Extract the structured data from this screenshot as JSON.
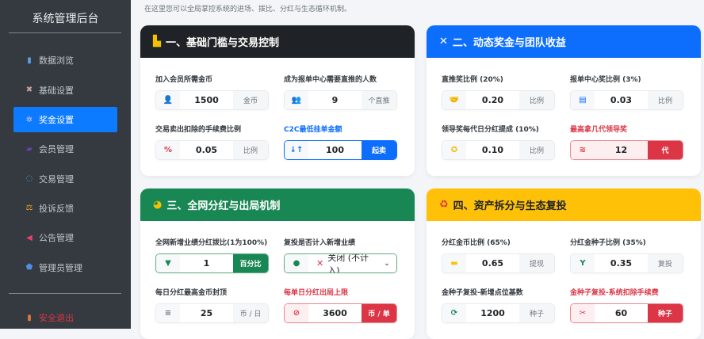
{
  "sidebar": {
    "title": "系统管理后台",
    "items": [
      {
        "label": "数据浏览",
        "icon": "bar-chart-icon",
        "glyph": "▮",
        "color": "#5aa0e6"
      },
      {
        "label": "基础设置",
        "icon": "tools-icon",
        "glyph": "✖",
        "color": "#c9a0a0"
      },
      {
        "label": "奖金设置",
        "icon": "gear-icon",
        "glyph": "✲",
        "color": "#d8c8ff",
        "active": true
      },
      {
        "label": "会员管理",
        "icon": "users-icon",
        "glyph": "▰",
        "color": "#6c3fb0"
      },
      {
        "label": "交易管理",
        "icon": "exchange-icon",
        "glyph": "◌",
        "color": "#4da3e0"
      },
      {
        "label": "投诉反馈",
        "icon": "scale-icon",
        "glyph": "⚖",
        "color": "#f0a020"
      },
      {
        "label": "公告管理",
        "icon": "megaphone-icon",
        "glyph": "◀",
        "color": "#e83e6c"
      },
      {
        "label": "管理员管理",
        "icon": "shield-icon",
        "glyph": "⬟",
        "color": "#4d8fe6"
      }
    ],
    "logout": {
      "label": "安全退出",
      "icon": "door-icon",
      "glyph": "▮",
      "color": "#e07a3a"
    }
  },
  "subtitle": "在这里您可以全局掌控系统的进场、拨比、分红与生态循环机制。",
  "cards": [
    {
      "title": "一、基础门槛与交易控制",
      "icon": "door-icon",
      "glyph": "▙",
      "icon_color": "#f5c000",
      "bg": "#1f2226",
      "fields": [
        {
          "label": "加入会员所需金币",
          "value": "1500",
          "suffix": "金币",
          "icon": "user-plus-icon",
          "glyph": "👤",
          "icolor": "#0d6efd"
        },
        {
          "label": "成为报单中心需要直推的人数",
          "value": "9",
          "suffix": "个直推",
          "icon": "users-icon",
          "glyph": "👥",
          "icolor": "#3ab0e0"
        },
        {
          "label": "交易卖出扣除的手续费比例",
          "value": "0.05",
          "suffix": "比例",
          "icon": "percent-icon",
          "glyph": "%",
          "icolor": "#dc3545"
        },
        {
          "label": "C2C最低挂单金额",
          "value": "100",
          "suffix": "起卖",
          "icon": "sort-icon",
          "glyph": "↓↑",
          "icolor": "#0d6efd",
          "style": "blue"
        }
      ]
    },
    {
      "title": "二、动态奖金与团队收益",
      "icon": "network-icon",
      "glyph": "✕",
      "icon_color": "#ffffff",
      "bg": "#0d6efd",
      "fields": [
        {
          "label": "直推奖比例 (20%)",
          "value": "0.20",
          "suffix": "比例",
          "icon": "handshake-icon",
          "glyph": "🤝",
          "icolor": "#0d6efd"
        },
        {
          "label": "报单中心奖比例 (3%)",
          "value": "0.03",
          "suffix": "比例",
          "icon": "store-icon",
          "glyph": "▤",
          "icolor": "#0d6efd"
        },
        {
          "label": "领导奖每代日分红提成 (10%)",
          "value": "0.10",
          "suffix": "比例",
          "icon": "award-icon",
          "glyph": "✪",
          "icolor": "#f5b800"
        },
        {
          "label": "最高拿几代领导奖",
          "value": "12",
          "suffix": "代",
          "icon": "layers-icon",
          "glyph": "≋",
          "icolor": "#dc3545",
          "style": "red"
        }
      ]
    },
    {
      "title": "三、全网分红与出局机制",
      "icon": "pie-chart-icon",
      "glyph": "◕",
      "icon_color": "#f5c000",
      "bg": "#198754",
      "fields": [
        {
          "label": "全网新增业绩分红拨比(1为100%)",
          "value": "1",
          "suffix": "百分比",
          "icon": "filter-icon",
          "glyph": "▼",
          "icolor": "#198754",
          "style": "green"
        },
        {
          "label": "复投是否计入新增业绩",
          "value": "关闭 (不计入)",
          "prefix": "✕",
          "suffix": "⌄",
          "icon": "toggle-icon",
          "glyph": "●",
          "icolor": "#198754",
          "style": "green sel"
        },
        {
          "label": "每日分红最高金币封顶",
          "value": "25",
          "suffix": "币 / 日",
          "icon": "coins-icon",
          "glyph": "≡",
          "icolor": "#6c757d"
        },
        {
          "label": "每单日分红出局上限",
          "value": "3600",
          "suffix": "币 / 单",
          "icon": "ban-icon",
          "glyph": "⊘",
          "icolor": "#dc3545",
          "style": "red wv"
        }
      ]
    },
    {
      "title": "四、资产拆分与生态复投",
      "icon": "recycle-icon",
      "glyph": "♻",
      "icon_color": "#dc3545",
      "bg": "#ffc107",
      "title_color": "#212529",
      "fields": [
        {
          "label": "分红金币比例 (65%)",
          "value": "0.65",
          "suffix": "提现",
          "icon": "wallet-icon",
          "glyph": "▬",
          "icolor": "#ffc107"
        },
        {
          "label": "分红金种子比例 (35%)",
          "value": "0.35",
          "suffix": "复投",
          "icon": "seedling-icon",
          "glyph": "Y",
          "icolor": "#198754"
        },
        {
          "label": "金种子复投-新增点位基数",
          "value": "1200",
          "suffix": "种子",
          "icon": "sync-icon",
          "glyph": "⟳",
          "icolor": "#198754"
        },
        {
          "label": "金种子复投-系统扣除手续费",
          "value": "60",
          "suffix": "种子",
          "icon": "scissors-icon",
          "glyph": "✂",
          "icolor": "#dc3545",
          "style": "red wv"
        }
      ]
    }
  ]
}
